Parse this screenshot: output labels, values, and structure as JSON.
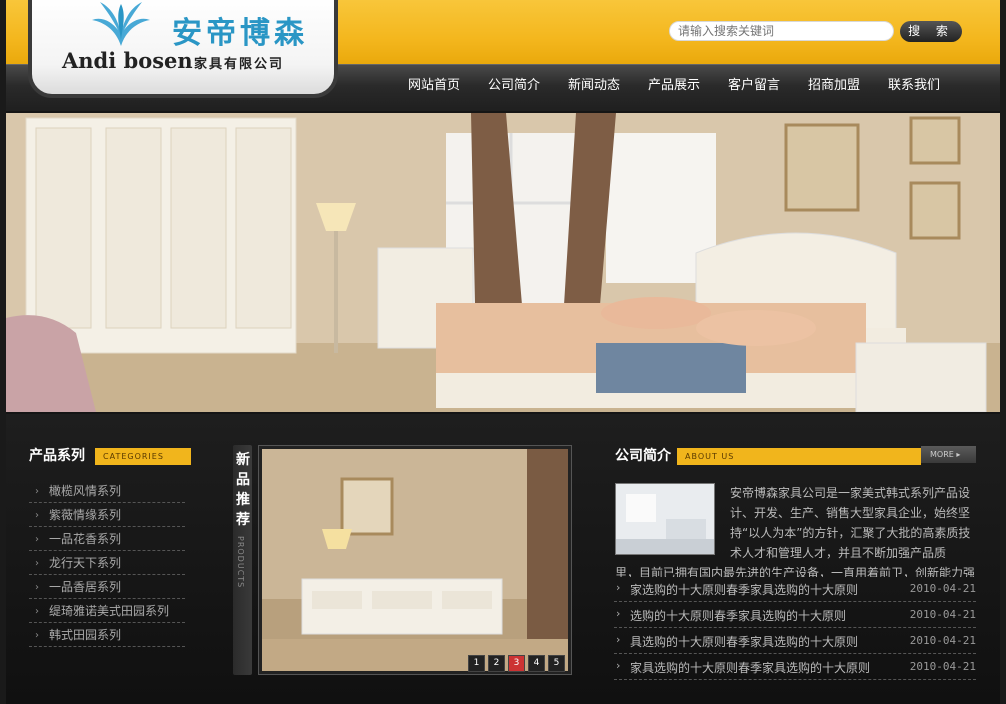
{
  "header": {
    "brand_cn": "安帝博森",
    "brand_en": "Andi bosen",
    "brand_sub": "家具有限公司",
    "search_placeholder": "请输入搜索关键词",
    "search_button": "搜 索"
  },
  "nav": [
    "网站首页",
    "公司简介",
    "新闻动态",
    "产品展示",
    "客户留言",
    "招商加盟",
    "联系我们"
  ],
  "categories": {
    "title": "产品系列",
    "tag": "CATEGORIES",
    "items": [
      "橄榄风情系列",
      "紫薇情缘系列",
      "一品花香系列",
      "龙行天下系列",
      "一品香居系列",
      "缇琦雅诺美式田园系列",
      "韩式田园系列"
    ]
  },
  "new_products": {
    "title": "新品推荐",
    "tag": "PRODUCTS",
    "pages": [
      "1",
      "2",
      "3",
      "4",
      "5"
    ],
    "active_page": "3"
  },
  "about": {
    "title": "公司简介",
    "tag": "ABOUT US",
    "more": "MORE",
    "text": "安帝博森家具公司是一家美式韩式系列产品设计、开发、生产、销售大型家具企业，始终坚持“以人为本”的方针，汇聚了大批的高素质技术人才和管理人才，并且不断加强产品质",
    "text_cont": "里，目前已拥有国内最先进的生产设备，一直用着前卫，创新能力强"
  },
  "news": [
    {
      "title": "家选购的十大原则春季家具选购的十大原则",
      "date": "2010-04-21"
    },
    {
      "title": "选购的十大原则春季家具选购的十大原则",
      "date": "2010-04-21"
    },
    {
      "title": "具选购的十大原则春季家具选购的十大原则",
      "date": "2010-04-21"
    },
    {
      "title": "家具选购的十大原则春季家具选购的十大原则",
      "date": "2010-04-21"
    }
  ],
  "colors": {
    "accent": "#f1b51c",
    "brand_blue": "#2a96c5",
    "dark": "#151515"
  }
}
